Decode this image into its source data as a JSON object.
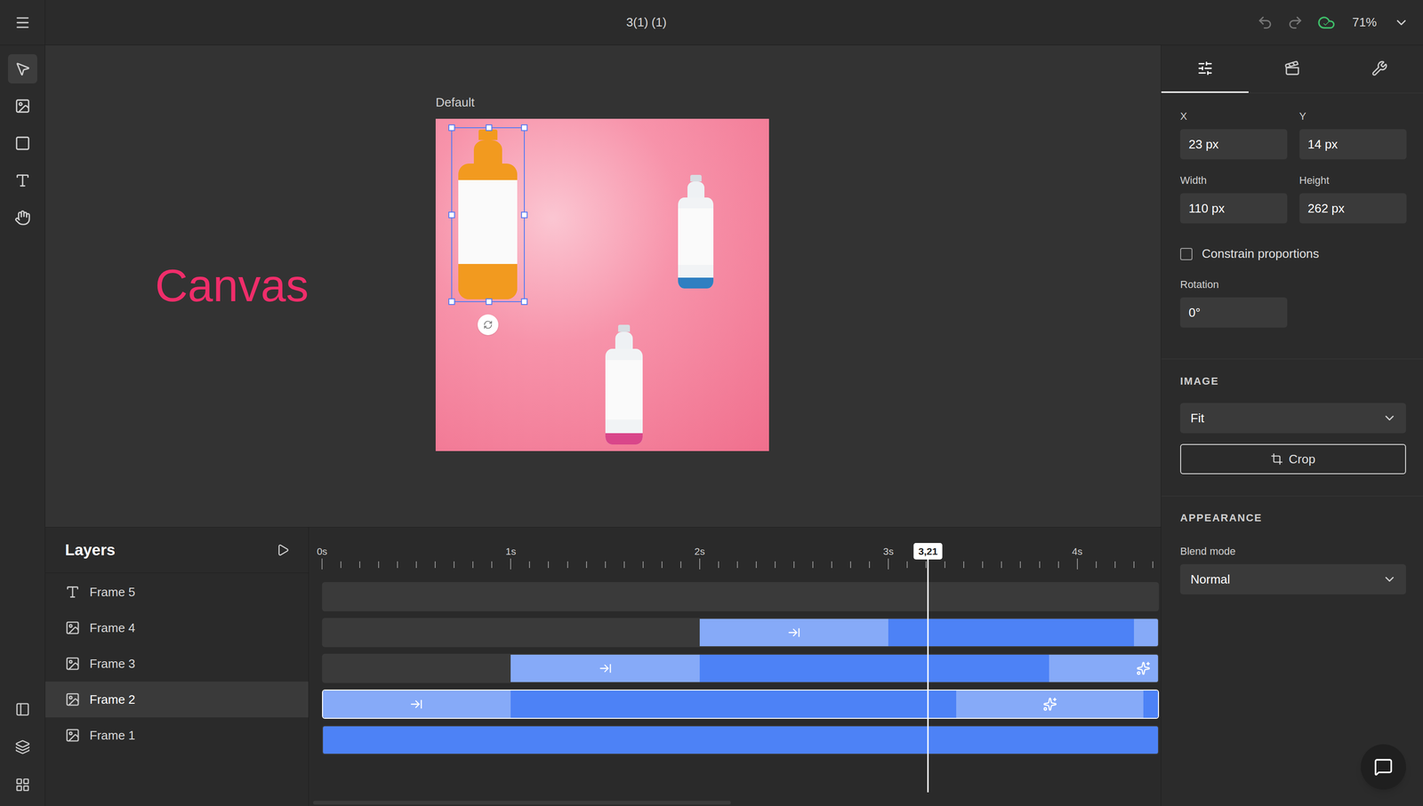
{
  "top_bar": {
    "title": "3(1) (1)",
    "zoom": "71%",
    "saved": true,
    "undo_enabled": false,
    "redo_enabled": false
  },
  "toolbar": {
    "tools": [
      {
        "selected": true
      },
      {
        "selected": false
      },
      {
        "selected": false
      },
      {
        "selected": false
      },
      {
        "selected": false
      }
    ]
  },
  "canvas": {
    "annotation": "Canvas",
    "artboard": {
      "label": "Default",
      "objects": [
        {
          "kind": "colored",
          "color": "#f29a1f",
          "selected": true
        },
        {
          "kind": "white",
          "color": "#2f7fc1",
          "selected": false
        },
        {
          "kind": "white",
          "color": "#d9468a",
          "selected": false
        }
      ]
    }
  },
  "inspector": {
    "tabs": [
      {
        "selected": true
      },
      {
        "selected": false
      },
      {
        "selected": false
      }
    ],
    "fields": [
      {
        "label": "X",
        "value": "23 px"
      },
      {
        "label": "Y",
        "value": "14 px"
      },
      {
        "label": "Width",
        "value": "110 px"
      },
      {
        "label": "Height",
        "value": "262 px"
      }
    ],
    "constrain_proportions": {
      "label": "Constrain proportions",
      "checked": false
    },
    "rotation": {
      "label": "Rotation",
      "value": "0°"
    },
    "image": {
      "heading": "IMAGE",
      "fit": "Fit",
      "crop_button": "Crop"
    },
    "appearance": {
      "heading": "APPEARANCE",
      "blend_mode_label": "Blend mode",
      "blend_mode": "Normal"
    }
  },
  "layers": {
    "title": "Layers",
    "items": [
      {
        "name": "Frame 5",
        "kind": "text",
        "selected": false,
        "segments": []
      },
      {
        "name": "Frame 4",
        "kind": "image",
        "selected": false,
        "segments": [
          {
            "kind": "enter",
            "start": 2.0,
            "end": 3.0
          },
          {
            "kind": "body",
            "start": 3.0,
            "end": 4.3
          },
          {
            "kind": "exit",
            "start": 4.3,
            "end": 5.3
          }
        ]
      },
      {
        "name": "Frame 3",
        "kind": "image",
        "selected": false,
        "segments": [
          {
            "kind": "enter",
            "start": 1.0,
            "end": 2.0
          },
          {
            "kind": "body",
            "start": 2.0,
            "end": 3.85
          },
          {
            "kind": "exit",
            "start": 3.85,
            "end": 4.85
          }
        ]
      },
      {
        "name": "Frame 2",
        "kind": "image",
        "selected": true,
        "segments": [
          {
            "kind": "enter",
            "start": 0.0,
            "end": 1.0
          },
          {
            "kind": "body",
            "start": 1.0,
            "end": 3.36
          },
          {
            "kind": "exit",
            "start": 3.36,
            "end": 4.35
          },
          {
            "kind": "body",
            "start": 4.35,
            "end": 5.35
          }
        ]
      },
      {
        "name": "Frame 1",
        "kind": "image",
        "selected": false,
        "segments": [
          {
            "kind": "body",
            "start": 0.0,
            "end": 5.0
          }
        ]
      }
    ]
  },
  "timeline": {
    "ticks": [
      "0s",
      "1s",
      "2s",
      "3s",
      "4s"
    ],
    "playhead": {
      "label": "3,21",
      "time": 3.21
    }
  }
}
